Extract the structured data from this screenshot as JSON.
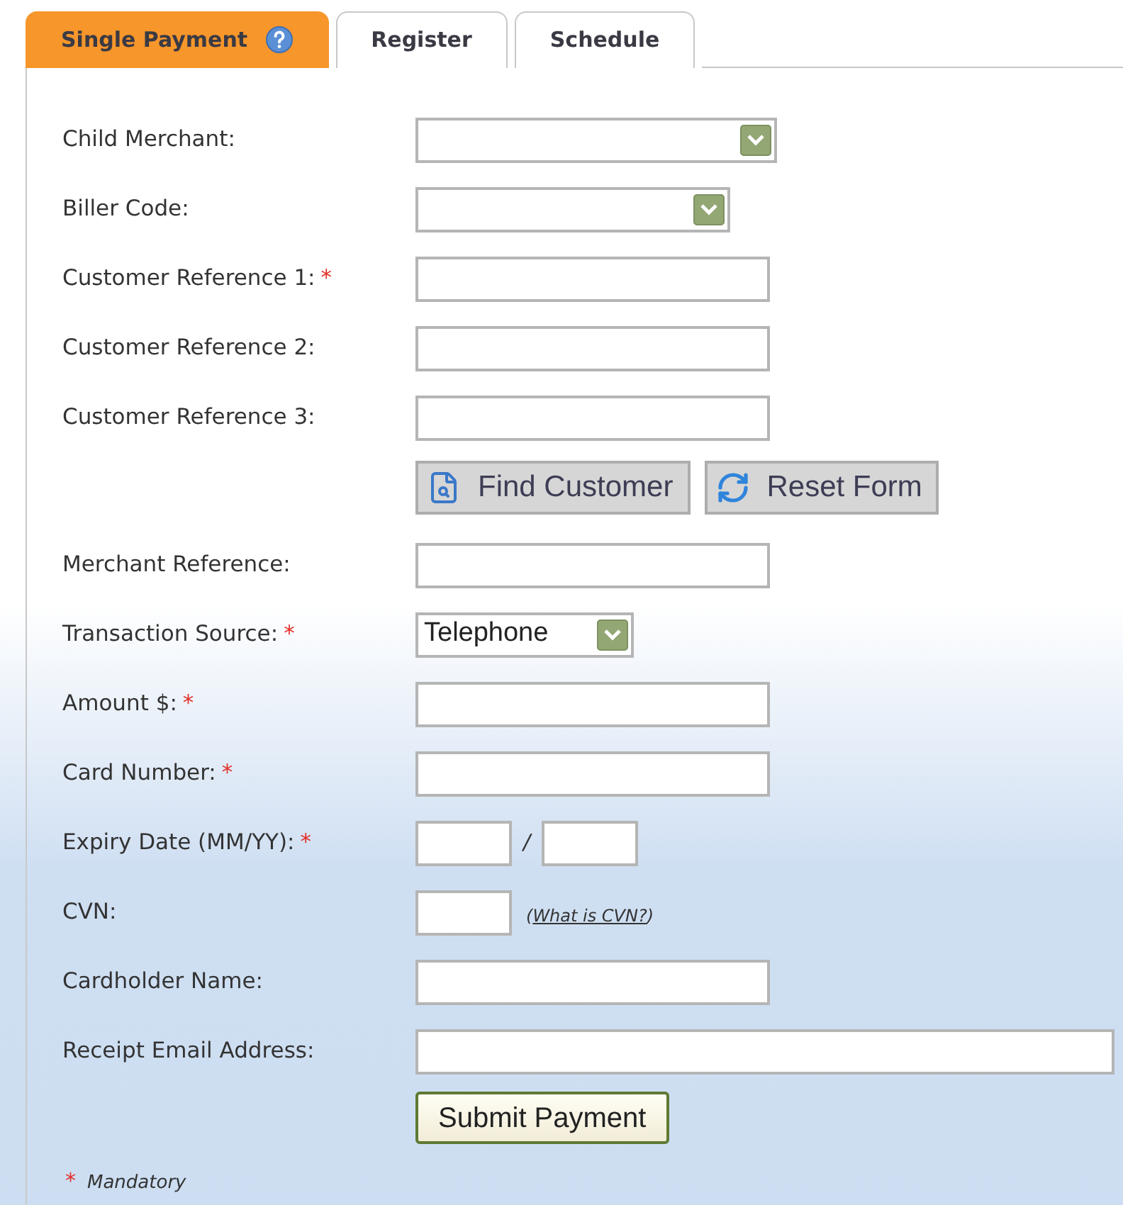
{
  "tabs": [
    {
      "label": "Single Payment",
      "selected": true,
      "help": true
    },
    {
      "label": "Register",
      "selected": false,
      "help": false
    },
    {
      "label": "Schedule",
      "selected": false,
      "help": false
    }
  ],
  "rows": [
    {
      "kind": "dropdown-wide",
      "label": "Child Merchant:"
    },
    {
      "kind": "dropdown",
      "label": "Biller Code:"
    },
    {
      "kind": "text",
      "label": "Customer Reference 1:",
      "required_mark": "*"
    },
    {
      "kind": "text",
      "label": "Customer Reference 2:"
    },
    {
      "kind": "text",
      "label": "Customer Reference 3:"
    },
    {
      "kind": "actions",
      "buttons": [
        {
          "label": "Find Customer",
          "kind": "find"
        },
        {
          "label": "Reset Form",
          "kind": "reset"
        }
      ]
    },
    {
      "kind": "text",
      "label": "Merchant Reference:"
    },
    {
      "kind": "dropdown-short",
      "label": "Transaction Source:",
      "required_mark": "*",
      "value": "Telephone"
    },
    {
      "kind": "text",
      "label": "Amount $:",
      "required_mark": "*"
    },
    {
      "kind": "text",
      "label": "Card Number:",
      "required_mark": "*"
    },
    {
      "kind": "expiry",
      "label": "Expiry Date (MM/YY):",
      "required_mark": "*",
      "separator": "/"
    },
    {
      "kind": "cvn",
      "label": "CVN:",
      "link_open": "(",
      "link": "What is CVN?",
      "link_close": ")"
    },
    {
      "kind": "text",
      "label": "Cardholder Name:"
    },
    {
      "kind": "text-wide",
      "label": "Receipt Email Address:"
    }
  ],
  "submit": "Submit Payment",
  "legend": {
    "mark": "*",
    "text": "Mandatory"
  }
}
